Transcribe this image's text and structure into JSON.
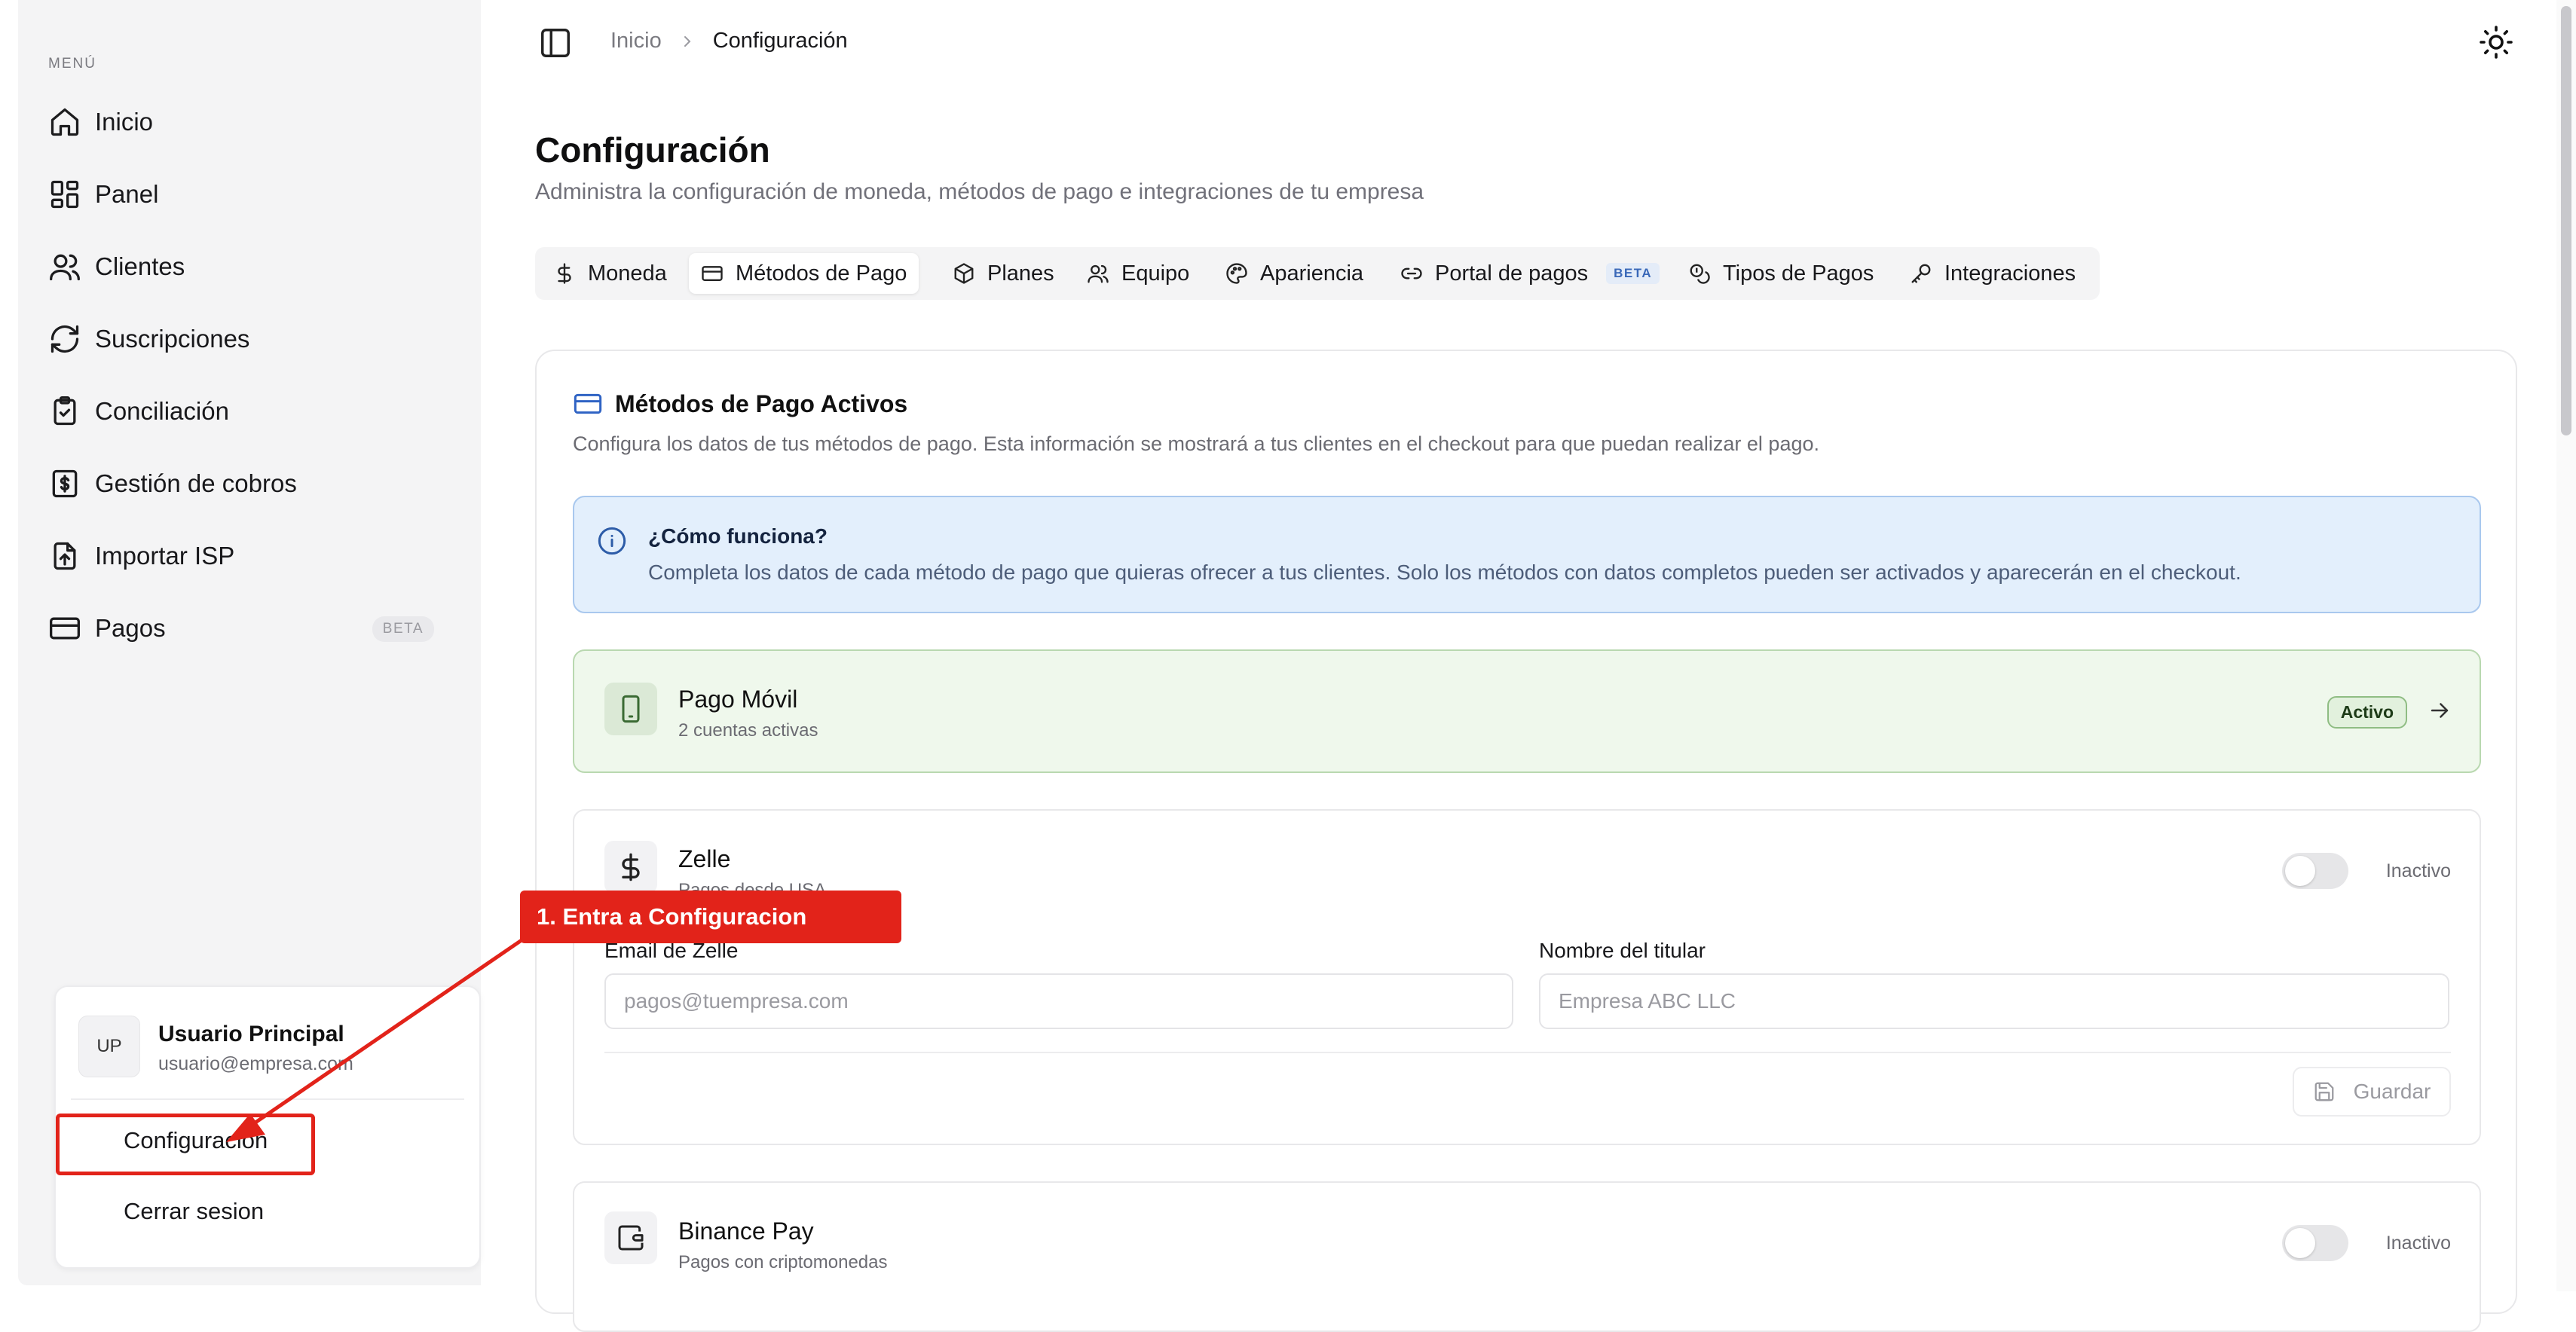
{
  "sidebar": {
    "menu_title": "MENÚ",
    "items": [
      {
        "label": "Inicio",
        "icon": "home-icon"
      },
      {
        "label": "Panel",
        "icon": "dashboard-icon"
      },
      {
        "label": "Clientes",
        "icon": "users-icon"
      },
      {
        "label": "Suscripciones",
        "icon": "refresh-icon"
      },
      {
        "label": "Conciliación",
        "icon": "clipboard-check-icon"
      },
      {
        "label": "Gestión de cobros",
        "icon": "dollar-receipt-icon"
      },
      {
        "label": "Importar ISP",
        "icon": "file-upload-icon"
      },
      {
        "label": "Pagos",
        "icon": "credit-card-icon",
        "badge": "BETA"
      }
    ],
    "user": {
      "initials": "UP",
      "name": "Usuario Principal",
      "email": "usuario@empresa.com",
      "menu": [
        "Configuracion",
        "Cerrar sesion"
      ]
    }
  },
  "header": {
    "breadcrumb": [
      "Inicio",
      "Configuración"
    ],
    "toggle_icon": "sidebar-toggle-icon",
    "theme_icon": "sun-icon"
  },
  "page": {
    "title": "Configuración",
    "subtitle": "Administra la configuración de moneda, métodos de pago e integraciones de tu empresa"
  },
  "tabs": [
    {
      "label": "Moneda",
      "icon": "dollar-icon"
    },
    {
      "label": "Métodos de Pago",
      "icon": "credit-card-icon",
      "active": true
    },
    {
      "label": "Planes",
      "icon": "package-icon"
    },
    {
      "label": "Equipo",
      "icon": "team-icon"
    },
    {
      "label": "Apariencia",
      "icon": "palette-icon"
    },
    {
      "label": "Portal de pagos",
      "icon": "link-icon",
      "badge": "BETA"
    },
    {
      "label": "Tipos de Pagos",
      "icon": "coins-icon"
    },
    {
      "label": "Integraciones",
      "icon": "key-icon"
    }
  ],
  "methods_card": {
    "title": "Métodos de Pago Activos",
    "description": "Configura los datos de tus métodos de pago. Esta información se mostrará a tus clientes en el checkout para que puedan realizar el pago.",
    "info": {
      "title": "¿Cómo funciona?",
      "text": "Completa los datos de cada método de pago que quieras ofrecer a tus clientes. Solo los métodos con datos completos pueden ser activados y aparecerán en el checkout."
    },
    "methods": [
      {
        "name": "Pago Móvil",
        "subtitle": "2 cuentas activas",
        "status": "Activo",
        "icon": "smartphone-icon"
      },
      {
        "name": "Zelle",
        "subtitle": "Pagos desde USA",
        "status": "Inactivo",
        "icon": "dollar-icon",
        "fields": [
          {
            "label": "Email de Zelle",
            "placeholder": "pagos@tuempresa.com",
            "value": ""
          },
          {
            "label": "Nombre del titular",
            "placeholder": "Empresa ABC LLC",
            "value": ""
          }
        ],
        "save_label": "Guardar"
      },
      {
        "name": "Binance Pay",
        "subtitle": "Pagos con criptomonedas",
        "status": "Inactivo",
        "icon": "wallet-icon"
      }
    ]
  },
  "annotation": {
    "label": "1. Entra a Configuracion",
    "color": "#e2231a"
  }
}
